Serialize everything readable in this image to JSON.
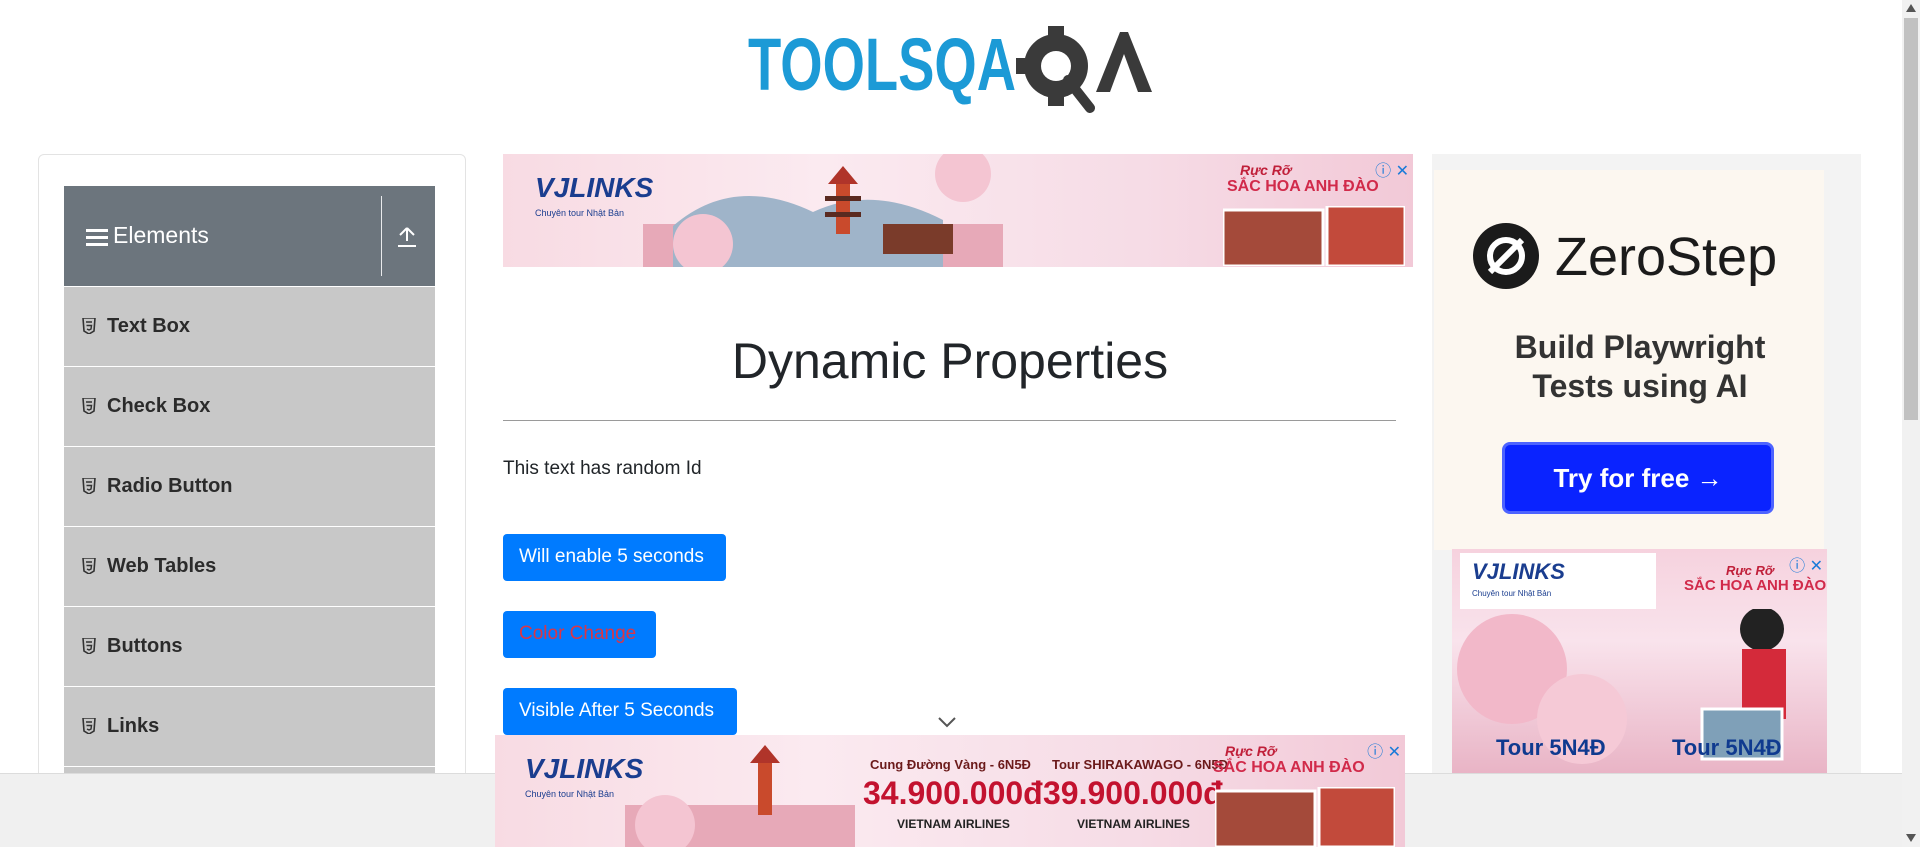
{
  "header": {
    "logo_text": "TOOLSQA",
    "logo_icon": "gear-magnifier-icon"
  },
  "sidebar": {
    "group_title": "Elements",
    "items": [
      {
        "label": "Text Box",
        "icon": "html5-icon"
      },
      {
        "label": "Check Box",
        "icon": "html5-icon"
      },
      {
        "label": "Radio Button",
        "icon": "html5-icon"
      },
      {
        "label": "Web Tables",
        "icon": "html5-icon"
      },
      {
        "label": "Buttons",
        "icon": "html5-icon"
      },
      {
        "label": "Links",
        "icon": "html5-icon"
      }
    ]
  },
  "main": {
    "title": "Dynamic Properties",
    "random_id_text": "This text has random Id",
    "buttons": {
      "enable_after": "Will enable 5 seconds",
      "color_change": "Color Change",
      "visible_after": "Visible After 5 Seconds"
    }
  },
  "ads": {
    "top_banner": {
      "brand": "VJLINKS",
      "brand_sub": "Chuyên tour Nhật Bản",
      "headline": "SẮC HOA ANH ĐÀO",
      "headline_pre": "Rực Rỡ"
    },
    "bottom_banner": {
      "brand": "VJLINKS",
      "brand_sub": "Chuyên tour Nhật Bản",
      "offer1_title": "Cung Đường Vàng - 6N5Đ",
      "offer1_price": "34.900.000đ",
      "offer2_title": "Tour SHIRAKAWAGO - 6N5Đ",
      "offer2_price": "39.900.000đ",
      "airline": "VIETNAM AIRLINES",
      "headline": "SẮC HOA ANH ĐÀO",
      "headline_pre": "Rực Rỡ"
    },
    "zerostep": {
      "brand": "ZeroStep",
      "tagline_line1": "Build Playwright",
      "tagline_line2": "Tests using AI",
      "cta": "Try for free →"
    },
    "right_banner": {
      "brand": "VJLINKS",
      "brand_sub": "Chuyên tour Nhật Bản",
      "headline_pre": "Rực Rỡ",
      "headline": "SẮC HOA ANH ĐÀO",
      "tour1": "Tour 5N4Đ",
      "tour2": "Tour 5N4Đ"
    }
  },
  "colors": {
    "primary": "#007bff",
    "sidebar_header": "#6c757d",
    "menu_item": "#c8c8c8",
    "danger_text": "#dc3545",
    "logo_blue": "#1c9ad6",
    "logo_dark": "#3a3a3a",
    "zerostep_cta": "#0a23ff"
  }
}
